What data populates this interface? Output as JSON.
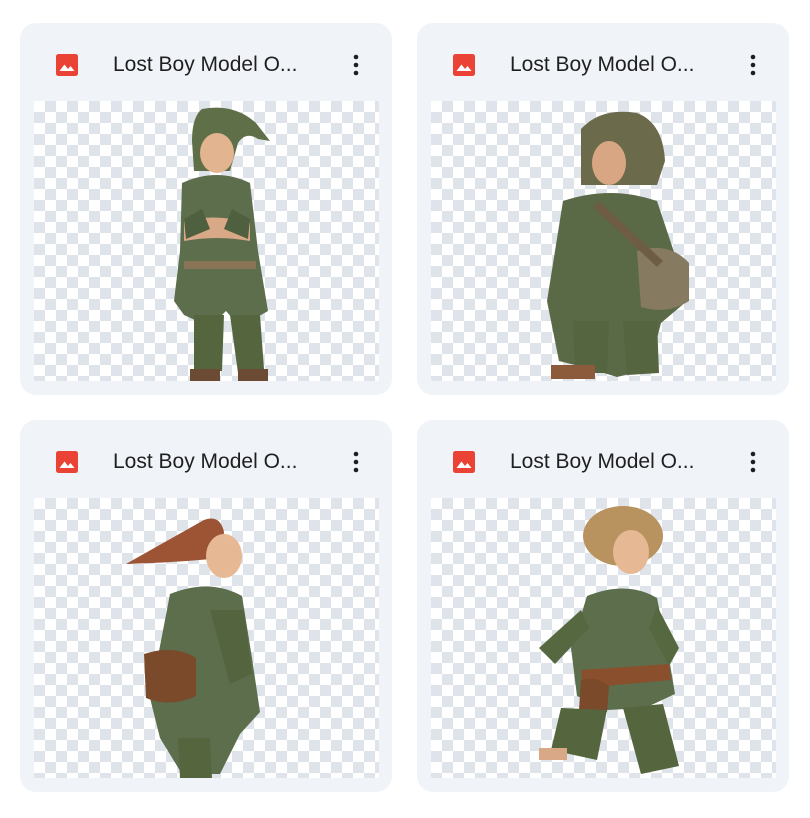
{
  "colors": {
    "card_bg": "#f0f4f9",
    "image_icon": "#ea4335",
    "text": "#1f1f1f",
    "checker": "#dfe3ea",
    "tunic_green": "#5c6e4c",
    "hat_rust": "#9c5434",
    "satchel_brown": "#7a4a2a"
  },
  "files": [
    {
      "name": "Lost Boy Model O...",
      "icon": "image-file-icon",
      "menu_icon": "more-vert-icon"
    },
    {
      "name": "Lost Boy Model O...",
      "icon": "image-file-icon",
      "menu_icon": "more-vert-icon"
    },
    {
      "name": "Lost Boy Model O...",
      "icon": "image-file-icon",
      "menu_icon": "more-vert-icon"
    },
    {
      "name": "Lost Boy Model O...",
      "icon": "image-file-icon",
      "menu_icon": "more-vert-icon"
    }
  ]
}
